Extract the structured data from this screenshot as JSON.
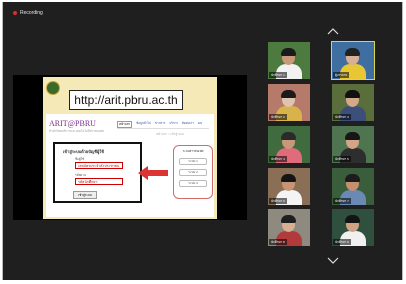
{
  "recording": {
    "label": "Recording"
  },
  "shared_screen": {
    "url": "http://arit.pbru.ac.th",
    "site": {
      "logo_text": "ARIT@PBRU",
      "subtitle": "สำนักวิทยบริการและเทคโนโลยีสารสนเทศ",
      "nav": [
        "หน้าแรก",
        "ข้อมูลทั่วไป",
        "ข่าวสาร",
        "บริการ",
        "ติดต่อเรา",
        "EN"
      ],
      "breadcrumb": "หน้าแรก > เข้าสู่ระบบ",
      "login": {
        "title": "เข้าสู่ระบบด้วยบัญชีผู้ใช้",
        "username_label": "ชื่อผู้ใช้",
        "username_value": "เลขบัตรประจำตัวประชาชน",
        "password_label": "รหัสผ่าน",
        "password_value": "รหัสนักศึกษา",
        "submit_label": "เข้าสู่ระบบ"
      },
      "side_panel": {
        "title": "ระบบสารสนเทศ",
        "buttons": [
          "ระบบ 1",
          "ระบบ 2",
          "ระบบ 3"
        ]
      }
    },
    "colors": {
      "slide_bg": "#f5e9b8",
      "highlight": "#cc0000"
    }
  },
  "gallery": {
    "active_speaker": "ผู้บรรยาย",
    "participants": [
      {
        "name": "นักศึกษา 1",
        "bg": "#4d7a3e",
        "skin": "#c99a7a",
        "hair": "#1b1b1b",
        "shirt": "#f2f2f2"
      },
      {
        "name": "ผู้บรรยาย",
        "bg": "#3e6fa0",
        "skin": "#d8b096",
        "hair": "#222222",
        "shirt": "#e8c634"
      },
      {
        "name": "นักศึกษา 2",
        "bg": "#b57a6a",
        "skin": "#e0c2ae",
        "hair": "#1a1a1a",
        "shirt": "#d8b24a"
      },
      {
        "name": "นักศึกษา 3",
        "bg": "#5a6e3b",
        "skin": "#d4a88c",
        "hair": "#111111",
        "shirt": "#3b4f7a"
      },
      {
        "name": "นักศึกษา 4",
        "bg": "#3f6b3f",
        "skin": "#c8987a",
        "hair": "#2a2a2a",
        "shirt": "#e06b7a"
      },
      {
        "name": "นักศึกษา 5",
        "bg": "#4f7550",
        "skin": "#d2a488",
        "hair": "#161616",
        "shirt": "#2e2e2e"
      },
      {
        "name": "นักศึกษา 6",
        "bg": "#8a6e55",
        "skin": "#c69576",
        "hair": "#151515",
        "shirt": "#f4f4f4"
      },
      {
        "name": "นักศึกษา 7",
        "bg": "#3a5e3c",
        "skin": "#c4906e",
        "hair": "#1c1c1c",
        "shirt": "#6a8ab5"
      },
      {
        "name": "นักศึกษา 8",
        "bg": "#8f8a80",
        "skin": "#d6b092",
        "hair": "#1f1f1f",
        "shirt": "#b33a3a"
      },
      {
        "name": "นักศึกษา 9",
        "bg": "#2f4f3f",
        "skin": "#cfa283",
        "hair": "#141414",
        "shirt": "#f0f0f0"
      }
    ]
  }
}
